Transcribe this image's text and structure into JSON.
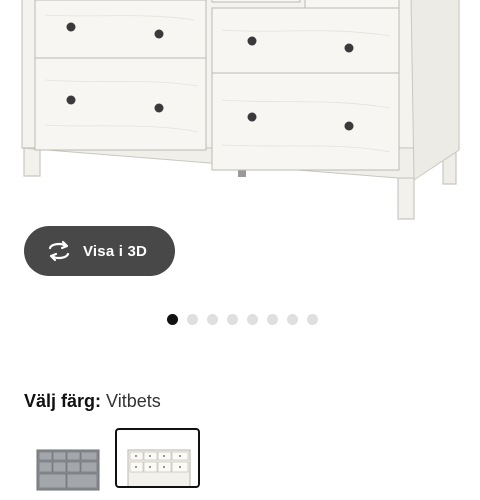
{
  "view_3d": {
    "label": "Visa i 3D",
    "icon": "rotate-3d-icon"
  },
  "carousel": {
    "count": 8,
    "active_index": 0
  },
  "color_picker": {
    "prefix": "Välj färg:",
    "selected": "Vitbets",
    "swatches": [
      {
        "name": "gray",
        "color": "#8a8d92",
        "selected": false
      },
      {
        "name": "white-stain",
        "color": "#f3f1ec",
        "selected": true
      }
    ]
  },
  "colors": {
    "button_bg": "#484848",
    "dot_active": "#111111",
    "dot_inactive": "#dfdfdf",
    "dresser": "#f4f3ef"
  }
}
